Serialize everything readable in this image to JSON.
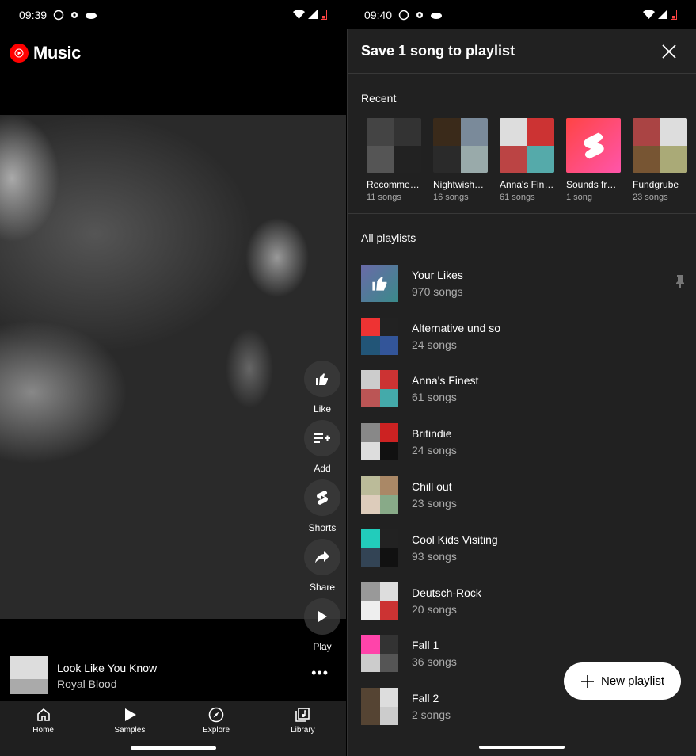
{
  "left": {
    "status": {
      "time": "09:39"
    },
    "brand": "Music",
    "actions": [
      {
        "label": "Like",
        "icon": "thumb-up-icon"
      },
      {
        "label": "Add",
        "icon": "playlist-add-icon"
      },
      {
        "label": "Shorts",
        "icon": "shorts-icon"
      },
      {
        "label": "Share",
        "icon": "share-icon"
      },
      {
        "label": "Play",
        "icon": "play-icon"
      }
    ],
    "player": {
      "title": "Look Like You Know",
      "artist": "Royal Blood",
      "more": "•••"
    },
    "nav": [
      {
        "label": "Home",
        "icon": "home-icon"
      },
      {
        "label": "Samples",
        "icon": "samples-icon"
      },
      {
        "label": "Explore",
        "icon": "explore-icon"
      },
      {
        "label": "Library",
        "icon": "library-icon"
      }
    ]
  },
  "right": {
    "status": {
      "time": "09:40"
    },
    "sheet_title": "Save 1 song to playlist",
    "recent_label": "Recent",
    "recent": [
      {
        "name": "Recommen…",
        "count": "11 songs",
        "colors": [
          "#444",
          "#333",
          "#555",
          "#222"
        ]
      },
      {
        "name": "Nightwish…",
        "count": "16 songs",
        "colors": [
          "#3a2a1a",
          "#7a8a9a",
          "#2a2a2a",
          "#9aa"
        ]
      },
      {
        "name": "Anna's Fine…",
        "count": "61 songs",
        "colors": [
          "#ddd",
          "#c33",
          "#b44",
          "#5aa"
        ]
      },
      {
        "name": "Sounds fro…",
        "count": "1 song",
        "colors": [
          "#f44",
          "#f5a",
          "#f4a",
          "#f46"
        ]
      },
      {
        "name": "Fundgrube",
        "count": "23 songs",
        "colors": [
          "#a44",
          "#ddd",
          "#753",
          "#aa7"
        ]
      }
    ],
    "all_label": "All playlists",
    "playlists": [
      {
        "name": "Your Likes",
        "count": "970 songs",
        "colors": [
          "#557",
          "#6a8",
          "#447",
          "#5a9"
        ],
        "pinned": true
      },
      {
        "name": "Alternative und so",
        "count": "24 songs",
        "colors": [
          "#e33",
          "#222",
          "#257",
          "#359"
        ],
        "pinned": false
      },
      {
        "name": "Anna's Finest",
        "count": "61 songs",
        "colors": [
          "#ccc",
          "#c33",
          "#b55",
          "#4aa"
        ],
        "pinned": false
      },
      {
        "name": "Britindie",
        "count": "24 songs",
        "colors": [
          "#888",
          "#c22",
          "#ddd",
          "#111"
        ],
        "pinned": false
      },
      {
        "name": "Chill out",
        "count": "23 songs",
        "colors": [
          "#bb9",
          "#a86",
          "#dcb",
          "#8a8"
        ],
        "pinned": false
      },
      {
        "name": "Cool Kids Visiting",
        "count": "93 songs",
        "colors": [
          "#2cb",
          "#222",
          "#345",
          "#111"
        ],
        "pinned": false
      },
      {
        "name": "Deutsch-Rock",
        "count": "20 songs",
        "colors": [
          "#999",
          "#ddd",
          "#eee",
          "#c33"
        ],
        "pinned": false
      },
      {
        "name": "Fall 1",
        "count": "36 songs",
        "colors": [
          "#f4a",
          "#333",
          "#ccc",
          "#555"
        ],
        "pinned": false
      },
      {
        "name": "Fall 2",
        "count": "2 songs",
        "colors": [
          "#543",
          "#ddd",
          "#543",
          "#ccc"
        ],
        "pinned": false
      }
    ],
    "new_playlist": "New playlist"
  }
}
